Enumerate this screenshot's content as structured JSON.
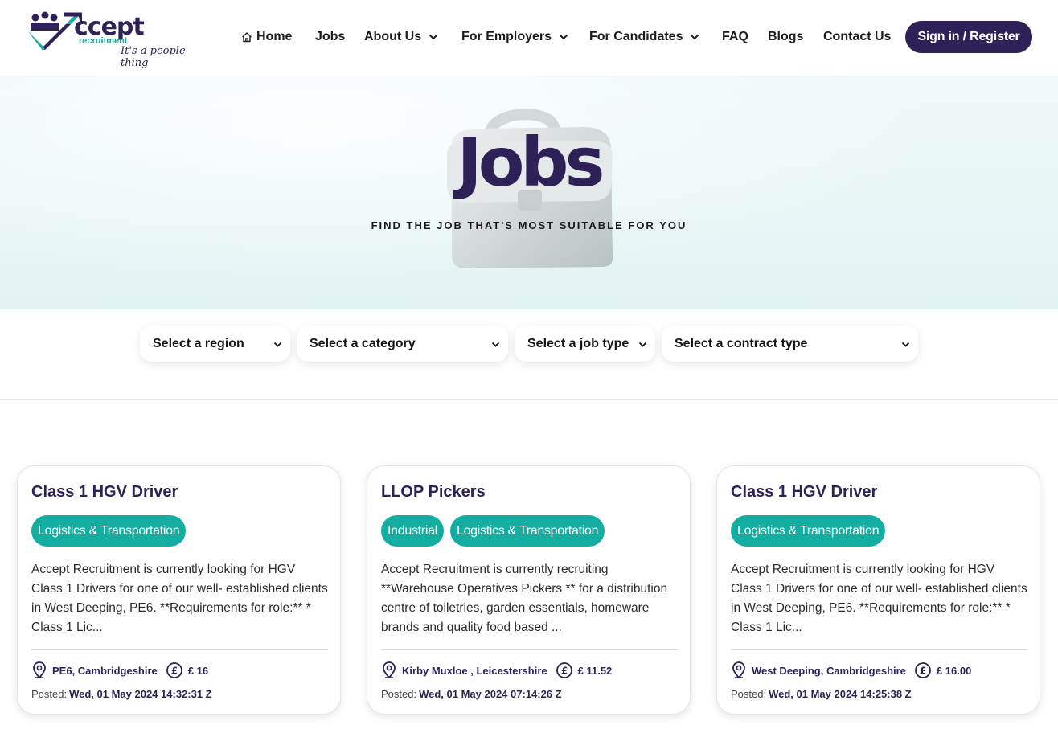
{
  "brand": {
    "name": "ccept",
    "sub": "recruitment",
    "tagline": "It's a people thing",
    "colors": {
      "primary": "#2e2157",
      "accent": "#13ada1"
    }
  },
  "nav": {
    "home": "Home",
    "jobs": "Jobs",
    "about": "About Us",
    "employers": "For Employers",
    "candidates": "For Candidates",
    "faq": "FAQ",
    "blogs": "Blogs",
    "contact": "Contact Us",
    "signin": "Sign in / Register"
  },
  "hero": {
    "title": "Jobs",
    "subtitle": "FIND THE JOB THAT'S MOST SUITABLE FOR YOU"
  },
  "filters": {
    "region": "Select a region",
    "category": "Select a category",
    "job_type": "Select a job type",
    "contract_type": "Select a contract type"
  },
  "jobs": [
    {
      "title": "Class 1 HGV Driver",
      "tags": [
        "Logistics & Transportation"
      ],
      "description": "Accept Recruitment is currently looking for HGV Class 1 Drivers for one of our well- established clients in West Deeping, PE6. **Requirements for role:** * Class 1 Lic...",
      "location": "PE6, Cambridgeshire",
      "pay": "£ 16",
      "posted_label": "Posted:",
      "posted": "Wed, 01 May 2024 14:32:31 Z"
    },
    {
      "title": "LLOP Pickers",
      "tags": [
        "Industrial",
        "Logistics & Transportation"
      ],
      "description": "Accept Recruitment is currently recruiting **Warehouse Operatives Pickers ** for a distribution centre of toiletries, garden essentials, homeware brands and quality food based ...",
      "location": "Kirby Muxloe , Leicestershire",
      "pay": "£ 11.52",
      "posted_label": "Posted:",
      "posted": "Wed, 01 May 2024 07:14:26 Z"
    },
    {
      "title": "Class 1 HGV Driver",
      "tags": [
        "Logistics & Transportation"
      ],
      "description": "Accept Recruitment is currently looking for HGV Class 1 Drivers for one of our well- established clients in West Deeping, PE6. **Requirements for role:** * Class 1 Lic...",
      "location": "West Deeping, Cambridgeshire",
      "pay": "£ 16.00",
      "posted_label": "Posted:",
      "posted": "Wed, 01 May 2024 14:25:38 Z"
    }
  ]
}
